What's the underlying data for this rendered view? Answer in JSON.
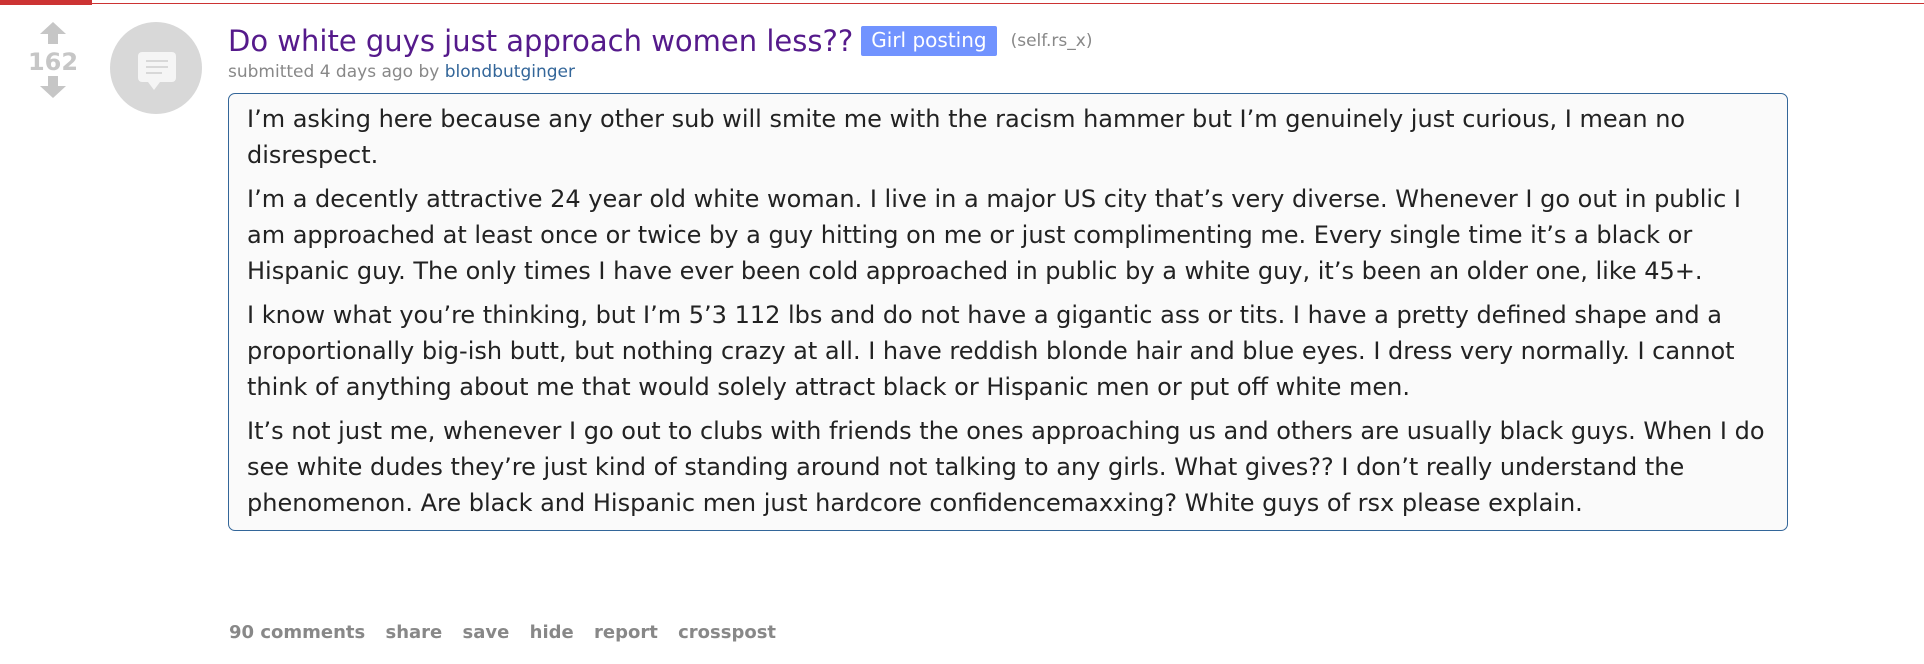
{
  "colors": {
    "accent_top": "#cc3333",
    "title": "#551a8b",
    "flair_bg": "#7193ff",
    "author": "#336699",
    "muted": "#888888",
    "vote_arrow": "#c6c6c6"
  },
  "vote": {
    "score": "162",
    "upvote_icon": "upvote-arrow",
    "downvote_icon": "downvote-arrow"
  },
  "thumbnail": {
    "icon": "self-post-icon"
  },
  "post": {
    "title": "Do white guys just approach women less??",
    "flair": "Girl posting",
    "domain": "(self.rs_x)",
    "submitted_prefix": "submitted ",
    "time_ago": "4 days ago",
    "by_text": " by ",
    "author": "blondbutginger",
    "paragraphs": [
      "I’m asking here because any other sub will smite me with the racism hammer but I’m genuinely just curious, I mean no disrespect.",
      "I’m a decently attractive 24 year old white woman. I live in a major US city that’s very diverse. Whenever I go out in public I am approached at least once or twice by a guy hitting on me or just complimenting me. Every single time it’s a black or Hispanic guy. The only times I have ever been cold approached in public by a white guy, it’s been an older one, like 45+.",
      "I know what you’re thinking, but I’m 5’3 112 lbs and do not have a gigantic ass or tits. I have a pretty defined shape and a proportionally big-ish butt, but nothing crazy at all. I have reddish blonde hair and blue eyes. I dress very normally. I cannot think of anything about me that would solely attract black or Hispanic men or put off white men.",
      "It’s not just me, whenever I go out to clubs with friends the ones approaching us and others are usually black guys. When I do see white dudes they’re just kind of standing around not talking to any girls. What gives?? I don’t really understand the phenomenon. Are black and Hispanic men just hardcore confidencemaxxing? White guys of rsx please explain."
    ]
  },
  "buttons": {
    "comments": "90 comments",
    "share": "share",
    "save": "save",
    "hide": "hide",
    "report": "report",
    "crosspost": "crosspost"
  }
}
